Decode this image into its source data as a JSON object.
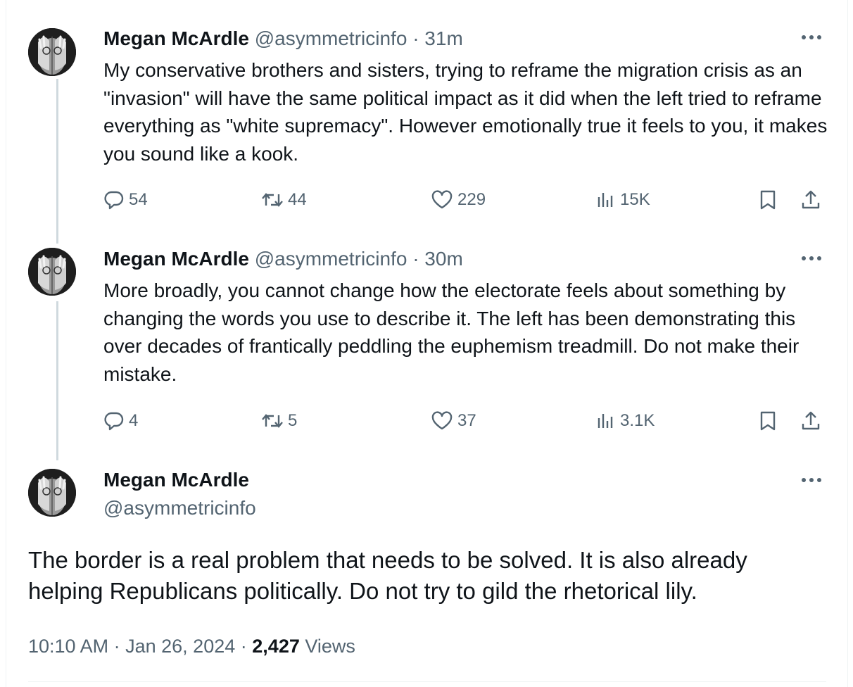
{
  "thread": [
    {
      "author_name": "Megan McArdle",
      "handle": "@asymmetricinfo",
      "separator": "·",
      "time": "31m",
      "text": "My conservative brothers and sisters, trying to reframe the migration crisis as an \"invasion\" will have the same political impact as it did when the left tried to reframe everything as \"white supremacy\". However emotionally true it feels to you, it makes you sound like a kook.",
      "replies": "54",
      "reposts": "44",
      "likes": "229",
      "views": "15K"
    },
    {
      "author_name": "Megan McArdle",
      "handle": "@asymmetricinfo",
      "separator": "·",
      "time": "30m",
      "text": "More broadly, you cannot change how the electorate feels about something by changing the words you use to describe it. The left has been demonstrating this over decades of frantically peddling the euphemism treadmill. Do not make their mistake.",
      "replies": "4",
      "reposts": "5",
      "likes": "37",
      "views": "3.1K"
    }
  ],
  "main_tweet": {
    "author_name": "Megan McArdle",
    "handle": "@asymmetricinfo",
    "text": "The border is a real problem that needs to be solved. It is also already helping Republicans politically. Do not try to gild the rhetorical lily.",
    "time": "10:10 AM",
    "date": "Jan 26, 2024",
    "separator": "·",
    "views_count": "2,427",
    "views_label": "Views"
  },
  "icons": {
    "reply": "reply-icon",
    "repost": "repost-icon",
    "like": "like-icon",
    "views": "views-icon",
    "bookmark": "bookmark-icon",
    "share": "share-icon",
    "more": "more-icon"
  },
  "colors": {
    "text_primary": "#0f1419",
    "text_secondary": "#536471",
    "thread_line": "#cfd9de",
    "divider": "#eff3f4"
  }
}
